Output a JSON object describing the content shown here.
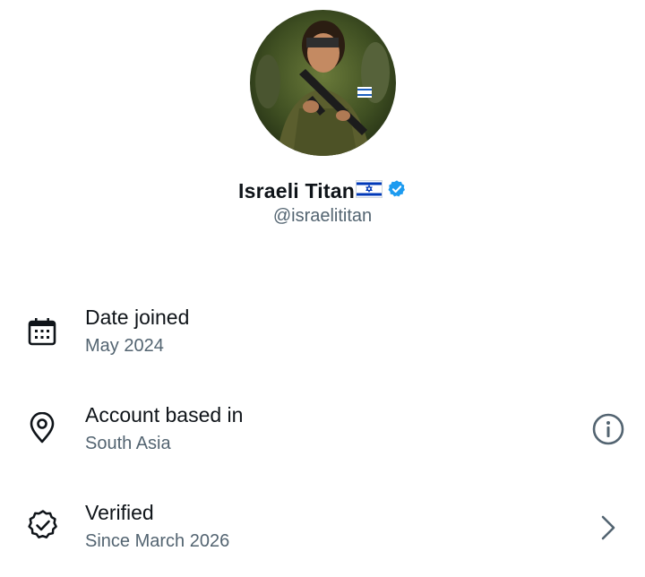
{
  "profile": {
    "display_name": "Israeli Titan",
    "flag_icon": "israel-flag-icon",
    "verified_icon": "verified-badge-icon",
    "handle": "@israelititan"
  },
  "rows": [
    {
      "icon": "calendar-icon",
      "title": "Date joined",
      "value": "May 2024"
    },
    {
      "icon": "location-pin-icon",
      "title": "Account based in",
      "value": "South Asia",
      "trailing_icon": "info-icon"
    },
    {
      "icon": "verified-check-icon",
      "title": "Verified",
      "value": "Since March 2026",
      "trailing_icon": "chevron-right-icon"
    }
  ],
  "colors": {
    "text_primary": "#0f1419",
    "text_secondary": "#536471",
    "verified_blue": "#1d9bf0"
  }
}
